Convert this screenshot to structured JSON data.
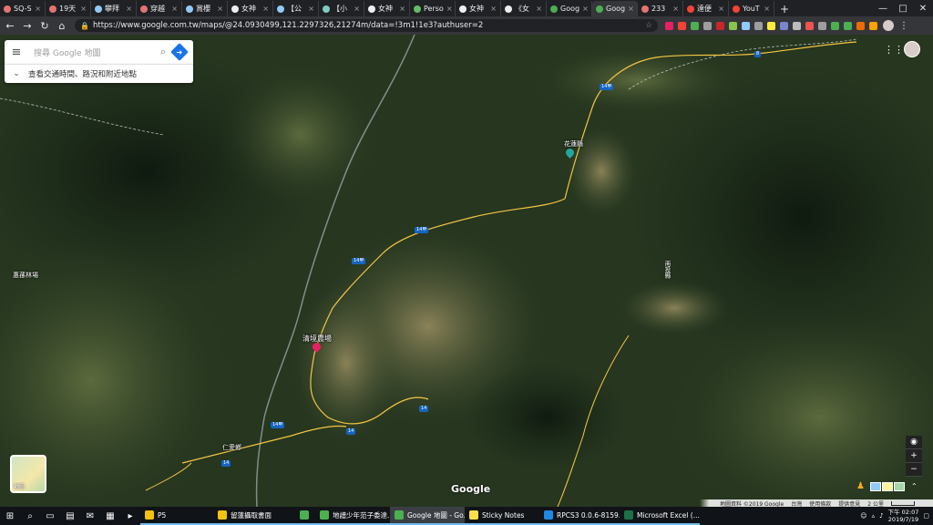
{
  "browser": {
    "tabs": [
      {
        "label": "SQ-S",
        "color": "#e57373"
      },
      {
        "label": "19天",
        "color": "#e57373"
      },
      {
        "label": "攀拜",
        "color": "#90caf9"
      },
      {
        "label": "穿越",
        "color": "#e57373"
      },
      {
        "label": "賞櫻",
        "color": "#90caf9"
      },
      {
        "label": "女神",
        "color": "#eeeeee"
      },
      {
        "label": "【公",
        "color": "#90caf9"
      },
      {
        "label": "【小",
        "color": "#80cbc4"
      },
      {
        "label": "女神",
        "color": "#eeeeee"
      },
      {
        "label": "Perso",
        "color": "#66bb6a"
      },
      {
        "label": "女神",
        "color": "#eeeeee"
      },
      {
        "label": "《女",
        "color": "#eeeeee"
      },
      {
        "label": "Goog",
        "color": "#4caf50"
      },
      {
        "label": "Goog",
        "color": "#4caf50",
        "active": true
      },
      {
        "label": "233",
        "color": "#e57373"
      },
      {
        "label": "達便",
        "color": "#f44336"
      },
      {
        "label": "YouT",
        "color": "#f44336"
      }
    ],
    "new_tab": "+",
    "url": "https://www.google.com.tw/maps/@24.0930499,121.2297326,21274m/data=!3m1!1e3?authuser=2"
  },
  "maps": {
    "search_placeholder": "搜尋 Google 地圖",
    "explore_text": "查看交通時間、路況和附近地點",
    "layer_label": "地圖",
    "logo": "Google",
    "footer": {
      "data_credit": "地圖資料 ©2019 Google",
      "region": "台灣",
      "terms": "使用條款",
      "feedback": "提供意見",
      "scale": "2 公里"
    },
    "labels": {
      "farm": "清境農場",
      "lushan": "惠蓀林場",
      "village_top": "花蓮縣",
      "village_mid": "南投縣",
      "road14": "14",
      "road14a": "14甲",
      "road8": "8",
      "renai": "仁愛鄉"
    }
  },
  "taskbar": {
    "apps": [
      {
        "label": "P5",
        "color": "#f4c20d"
      },
      {
        "label": "留蓮攝取書面",
        "color": "#f4c20d"
      },
      {
        "label": "",
        "color": "#4caf50"
      },
      {
        "label": "地譜少年范子委達...",
        "color": "#4caf50"
      },
      {
        "label": "Google 地圖 - Go...",
        "color": "#4caf50",
        "active": true
      },
      {
        "label": "Sticky Notes",
        "color": "#f9e04b"
      },
      {
        "label": "RPCS3 0.0.6-8159...",
        "color": "#1e88e5"
      },
      {
        "label": "Microsoft Excel (...",
        "color": "#1e7145"
      }
    ],
    "clock_time": "下午 02:07",
    "clock_date": "2019/7/19"
  }
}
